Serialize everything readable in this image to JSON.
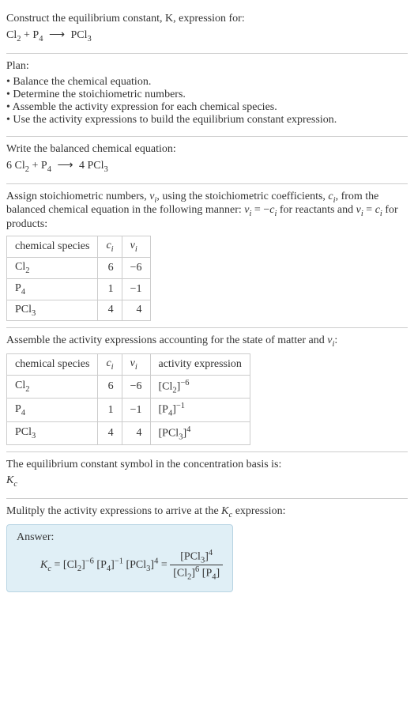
{
  "prompt": {
    "line1": "Construct the equilibrium constant, K, expression for:",
    "reaction_lhs_a": "Cl",
    "reaction_lhs_a_sub": "2",
    "plus1": " + ",
    "reaction_lhs_b": "P",
    "reaction_lhs_b_sub": "4",
    "arrow": "⟶",
    "reaction_rhs": "PCl",
    "reaction_rhs_sub": "3"
  },
  "plan": {
    "heading": "Plan:",
    "items": [
      "Balance the chemical equation.",
      "Determine the stoichiometric numbers.",
      "Assemble the activity expression for each chemical species.",
      "Use the activity expressions to build the equilibrium constant expression."
    ]
  },
  "balanced": {
    "heading": "Write the balanced chemical equation:",
    "c1": "6 ",
    "sp1": "Cl",
    "sp1_sub": "2",
    "plus": " + ",
    "sp2": "P",
    "sp2_sub": "4",
    "arrow": "⟶",
    "c3": "4 ",
    "sp3": "PCl",
    "sp3_sub": "3"
  },
  "stoich": {
    "text_a": "Assign stoichiometric numbers, ",
    "nu": "ν",
    "sub_i": "i",
    "text_b": ", using the stoichiometric coefficients, ",
    "c": "c",
    "text_c": ", from the balanced chemical equation in the following manner: ",
    "rel1_a": " = −",
    "text_d": " for reactants and ",
    "rel2_a": " = ",
    "text_e": " for products:",
    "headers": {
      "h1": "chemical species",
      "h2": "c",
      "h2_sub": "i",
      "h3": "ν",
      "h3_sub": "i"
    },
    "rows": [
      {
        "sp": "Cl",
        "sp_sub": "2",
        "c": "6",
        "nu": "−6"
      },
      {
        "sp": "P",
        "sp_sub": "4",
        "c": "1",
        "nu": "−1"
      },
      {
        "sp": "PCl",
        "sp_sub": "3",
        "c": "4",
        "nu": "4"
      }
    ]
  },
  "activity": {
    "heading_a": "Assemble the activity expressions accounting for the state of matter and ",
    "nu": "ν",
    "sub_i": "i",
    "heading_b": ":",
    "headers": {
      "h1": "chemical species",
      "h2": "c",
      "h2_sub": "i",
      "h3": "ν",
      "h3_sub": "i",
      "h4": "activity expression"
    },
    "rows": [
      {
        "sp": "Cl",
        "sp_sub": "2",
        "c": "6",
        "nu": "−6",
        "base": "[Cl",
        "base_sub": "2",
        "close": "]",
        "exp": "−6"
      },
      {
        "sp": "P",
        "sp_sub": "4",
        "c": "1",
        "nu": "−1",
        "base": "[P",
        "base_sub": "4",
        "close": "]",
        "exp": "−1"
      },
      {
        "sp": "PCl",
        "sp_sub": "3",
        "c": "4",
        "nu": "4",
        "base": "[PCl",
        "base_sub": "3",
        "close": "]",
        "exp": "4"
      }
    ]
  },
  "symbol": {
    "text": "The equilibrium constant symbol in the concentration basis is:",
    "K": "K",
    "sub": "c"
  },
  "multiply": {
    "text_a": "Mulitply the activity expressions to arrive at the ",
    "K": "K",
    "sub": "c",
    "text_b": " expression:"
  },
  "answer": {
    "label": "Answer:",
    "K": "K",
    "K_sub": "c",
    "eq": " = ",
    "t1": "[Cl",
    "t1_sub": "2",
    "t1_close": "]",
    "t1_exp": "−6",
    "sp": " ",
    "t2": "[P",
    "t2_sub": "4",
    "t2_close": "]",
    "t2_exp": "−1",
    "t3": "[PCl",
    "t3_sub": "3",
    "t3_close": "]",
    "t3_exp": "4",
    "eq2": " = ",
    "num": "[PCl",
    "num_sub": "3",
    "num_close": "]",
    "num_exp": "4",
    "den1": "[Cl",
    "den1_sub": "2",
    "den1_close": "]",
    "den1_exp": "6",
    "den2": "[P",
    "den2_sub": "4",
    "den2_close": "]"
  }
}
